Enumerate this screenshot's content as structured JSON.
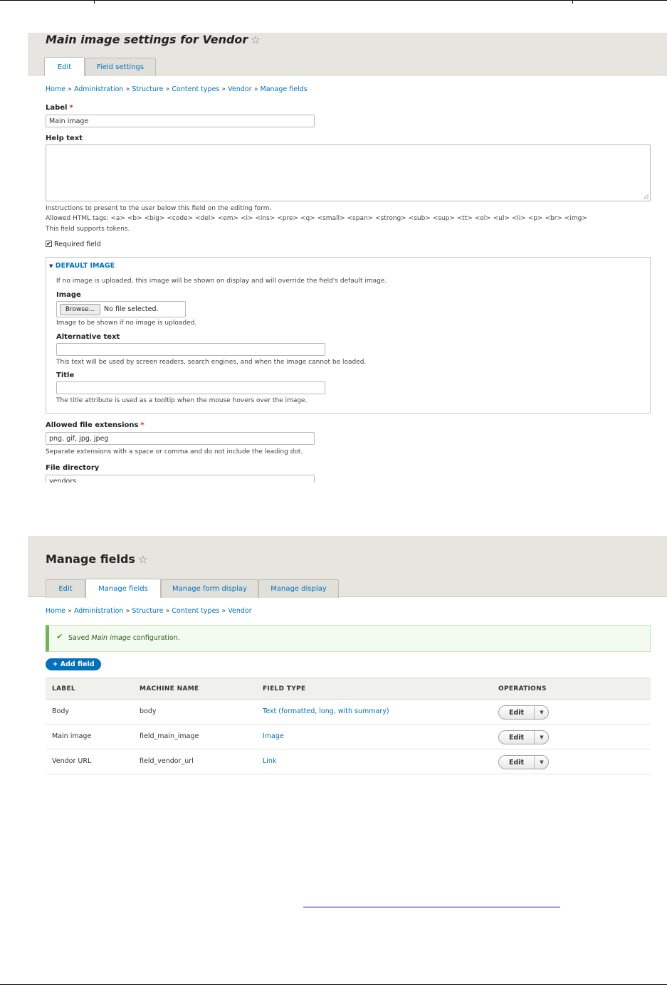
{
  "settings": {
    "title_prefix": "Main image settings for ",
    "title_entity": "Vendor",
    "tabs": [
      {
        "label": "Edit"
      },
      {
        "label": "Field settings"
      }
    ],
    "breadcrumb": [
      "Home",
      "Administration",
      "Structure",
      "Content types",
      "Vendor",
      "Manage fields"
    ],
    "breadcrumb_sep": "»",
    "label_field": {
      "label": "Label",
      "value": "Main image"
    },
    "help_text": {
      "label": "Help text",
      "value": "",
      "description1": "Instructions to present to the user below this field on the editing form.",
      "description2": "Allowed HTML tags: <a> <b> <big> <code> <del> <em> <i> <ins> <pre> <q> <small> <span> <strong> <sub> <sup> <tt> <ol> <ul> <li> <p> <br> <img>",
      "description3": "This field supports tokens."
    },
    "required": {
      "label": "Required field",
      "checked": true
    },
    "default_image": {
      "summary": "DEFAULT IMAGE",
      "intro": "If no image is uploaded, this image will be shown on display and will override the field's default image.",
      "image_label": "Image",
      "browse_label": "Browse...",
      "file_status": "No file selected.",
      "image_desc": "Image to be shown if no image is uploaded.",
      "alt_label": "Alternative text",
      "alt_value": "",
      "alt_desc": "This text will be used by screen readers, search engines, and when the image cannot be loaded.",
      "title_label": "Title",
      "title_value": "",
      "title_desc": "The title attribute is used as a tooltip when the mouse hovers over the image."
    },
    "extensions": {
      "label": "Allowed file extensions",
      "value": "png, gif, jpg, jpeg",
      "desc": "Separate extensions with a space or comma and do not include the leading dot."
    },
    "directory": {
      "label": "File directory",
      "value": "vendors"
    }
  },
  "manage": {
    "title": "Manage fields",
    "tabs": [
      {
        "label": "Edit"
      },
      {
        "label": "Manage fields"
      },
      {
        "label": "Manage form display"
      },
      {
        "label": "Manage display"
      }
    ],
    "breadcrumb": [
      "Home",
      "Administration",
      "Structure",
      "Content types",
      "Vendor"
    ],
    "message_prefix": "Saved ",
    "message_em": "Main image",
    "message_suffix": " configuration.",
    "add_field": "+ Add field",
    "columns": [
      "LABEL",
      "MACHINE NAME",
      "FIELD TYPE",
      "OPERATIONS"
    ],
    "rows": [
      {
        "label": "Body",
        "machine": "body",
        "type": "Text (formatted, long, with summary)",
        "op": "Edit"
      },
      {
        "label": "Main image",
        "machine": "field_main_image",
        "type": "Image",
        "op": "Edit"
      },
      {
        "label": "Vendor URL",
        "machine": "field_vendor_url",
        "type": "Link",
        "op": "Edit"
      }
    ]
  },
  "colors": {
    "link": "#0074bd",
    "header_bg": "#e6e5df",
    "primary_button": "#0071b8",
    "success": "#77b259",
    "required": "#e32700"
  },
  "icons": [
    "star-icon",
    "checkmark-icon",
    "chevron-down-icon",
    "caret-down-icon",
    "resize-grip-icon"
  ]
}
